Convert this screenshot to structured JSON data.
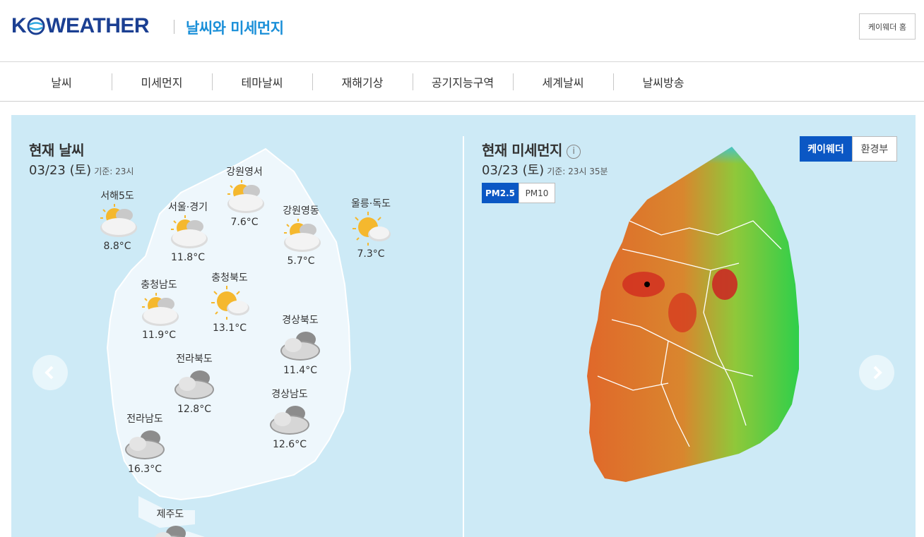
{
  "header": {
    "logo_text_left": "K",
    "logo_text_right": "WEATHER",
    "subtitle": "날씨와 미세먼지",
    "home_button": "케이웨더 홈"
  },
  "nav": {
    "items": [
      "날씨",
      "미세먼지",
      "테마날씨",
      "재해기상",
      "공기지능구역",
      "세계날씨",
      "날씨방송"
    ]
  },
  "weather": {
    "title": "현재 날씨",
    "date": "03/23 (토)",
    "base_time": "기준: 23시",
    "stations": [
      {
        "name": "서해5도",
        "temp": "8.8°C",
        "icon": "partly-cloudy-icon"
      },
      {
        "name": "서울·경기",
        "temp": "11.8°C",
        "icon": "partly-cloudy-icon"
      },
      {
        "name": "강원영서",
        "temp": "7.6°C",
        "icon": "partly-cloudy-icon"
      },
      {
        "name": "강원영동",
        "temp": "5.7°C",
        "icon": "partly-cloudy-icon"
      },
      {
        "name": "울릉·독도",
        "temp": "7.3°C",
        "icon": "partly-sunny-icon"
      },
      {
        "name": "충청남도",
        "temp": "11.9°C",
        "icon": "partly-cloudy-icon"
      },
      {
        "name": "충청북도",
        "temp": "13.1°C",
        "icon": "partly-sunny-icon"
      },
      {
        "name": "경상북도",
        "temp": "11.4°C",
        "icon": "cloudy-icon"
      },
      {
        "name": "전라북도",
        "temp": "12.8°C",
        "icon": "cloudy-icon"
      },
      {
        "name": "경상남도",
        "temp": "12.6°C",
        "icon": "cloudy-icon"
      },
      {
        "name": "전라남도",
        "temp": "16.3°C",
        "icon": "cloudy-icon"
      },
      {
        "name": "제주도",
        "temp": "",
        "icon": "cloudy-icon"
      }
    ]
  },
  "dust": {
    "title": "현재 미세먼지",
    "date": "03/23 (토)",
    "base_time": "기준: 23시 35분",
    "pm_tabs": [
      "PM2.5",
      "PM10"
    ],
    "source_tabs": [
      "케이웨더",
      "환경부"
    ]
  },
  "colors": {
    "brand": "#1b3f92",
    "subtitle": "#1a8fd8",
    "panel_bg": "#cdeaf6",
    "active_tab": "#0b57c4"
  }
}
